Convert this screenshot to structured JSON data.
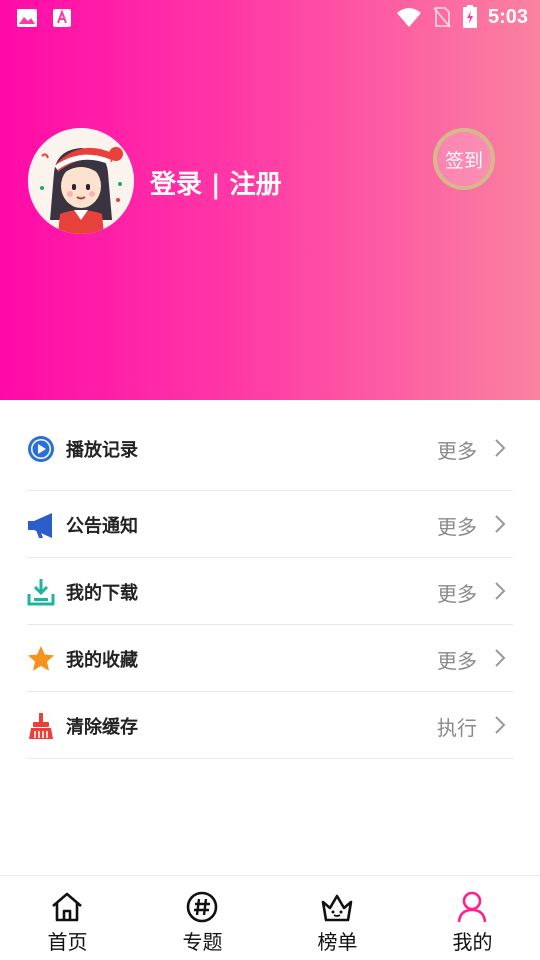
{
  "status_bar": {
    "time": "5:03",
    "left_icons": [
      "image-icon",
      "font-download-icon"
    ],
    "right_icons": [
      "wifi-icon",
      "no-sim-icon",
      "battery-charging-icon"
    ]
  },
  "profile": {
    "login_text": "登录 | 注册",
    "signin_label": "签到"
  },
  "menu": {
    "items": [
      {
        "label": "播放记录",
        "action": "更多",
        "icon": "play-circle-icon",
        "color": "#2a6fdb"
      },
      {
        "label": "公告通知",
        "action": "更多",
        "icon": "megaphone-icon",
        "color": "#2a5fc9"
      },
      {
        "label": "我的下载",
        "action": "更多",
        "icon": "download-tray-icon",
        "color": "#1fb59a"
      },
      {
        "label": "我的收藏",
        "action": "更多",
        "icon": "star-icon",
        "color": "#f6921e"
      },
      {
        "label": "清除缓存",
        "action": "执行",
        "icon": "broom-icon",
        "color": "#e8413c"
      }
    ]
  },
  "bottom_nav": {
    "items": [
      {
        "label": "首页",
        "icon": "home-icon"
      },
      {
        "label": "专题",
        "icon": "hashtag-icon"
      },
      {
        "label": "榜单",
        "icon": "crown-icon"
      },
      {
        "label": "我的",
        "icon": "profile-icon",
        "active": true
      }
    ],
    "active_color": "#ff1f8e"
  }
}
